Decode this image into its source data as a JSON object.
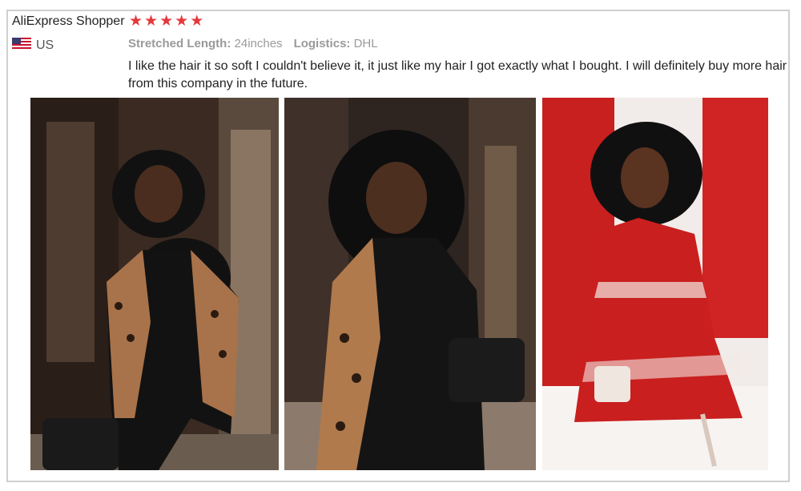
{
  "review": {
    "reviewer_name": "AliExpress Shopper",
    "rating": 5,
    "rating_color": "#e4393c",
    "country": "US",
    "country_flag_icon": "us-flag-icon",
    "attributes": [
      {
        "key": "Stretched Length:",
        "value": "24inches"
      },
      {
        "key": "Logistics:",
        "value": "DHL"
      }
    ],
    "text": "I like the hair it so soft I couldn't believe it, it just like my hair I got exactly what I bought. I will definitely buy more hair from this company in the future."
  },
  "photos": [
    {
      "name": "review-photo-1"
    },
    {
      "name": "review-photo-2"
    },
    {
      "name": "review-photo-3"
    }
  ]
}
